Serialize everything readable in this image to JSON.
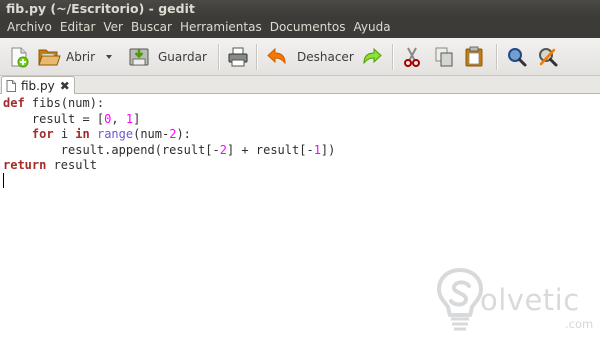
{
  "window": {
    "title": "fib.py (~/Escritorio) - gedit"
  },
  "menu": [
    "Archivo",
    "Editar",
    "Ver",
    "Buscar",
    "Herramientas",
    "Documentos",
    "Ayuda"
  ],
  "toolbar": {
    "open_label": "Abrir",
    "save_label": "Guardar",
    "undo_label": "Deshacer",
    "colors": {
      "save_green": "#4e9a06",
      "undo_orange": "#f57900",
      "redo_green": "#73d216",
      "search_blue": "#3465a4"
    }
  },
  "tab": {
    "label": "fib.py",
    "close_glyph": "✖"
  },
  "code": {
    "lines": [
      [
        {
          "t": "kw",
          "v": "def"
        },
        {
          "t": "plain",
          "v": " fibs(num):"
        }
      ],
      [
        {
          "t": "plain",
          "v": "    result = ["
        },
        {
          "t": "num",
          "v": "0"
        },
        {
          "t": "plain",
          "v": ", "
        },
        {
          "t": "num",
          "v": "1"
        },
        {
          "t": "plain",
          "v": "]"
        }
      ],
      [
        {
          "t": "plain",
          "v": "    "
        },
        {
          "t": "kw",
          "v": "for"
        },
        {
          "t": "plain",
          "v": " i "
        },
        {
          "t": "kw",
          "v": "in"
        },
        {
          "t": "plain",
          "v": " "
        },
        {
          "t": "bi",
          "v": "range"
        },
        {
          "t": "plain",
          "v": "(num-"
        },
        {
          "t": "num",
          "v": "2"
        },
        {
          "t": "plain",
          "v": "):"
        }
      ],
      [
        {
          "t": "plain",
          "v": "        result.append(result[-"
        },
        {
          "t": "num",
          "v": "2"
        },
        {
          "t": "plain",
          "v": "] + result[-"
        },
        {
          "t": "num",
          "v": "1"
        },
        {
          "t": "plain",
          "v": "])"
        }
      ],
      [
        {
          "t": "kw",
          "v": "return"
        },
        {
          "t": "plain",
          "v": " result"
        }
      ],
      []
    ],
    "colors": {
      "keyword": "#a52a2a",
      "builtin": "#6a5acd",
      "number": "#ff00ff"
    }
  },
  "watermark": {
    "brand": "olvetic",
    "tld": ".com"
  }
}
